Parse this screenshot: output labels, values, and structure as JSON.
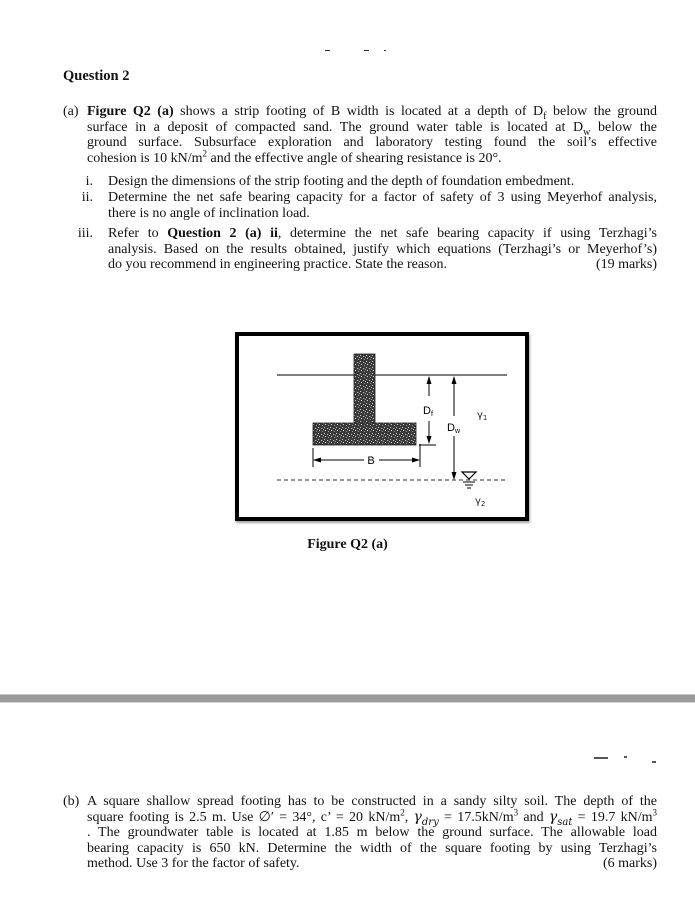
{
  "question": {
    "title": "Question 2",
    "part_a": {
      "label": "(a)",
      "lines": [
        [
          "Figure Q2 (a)",
          " shows a strip footing of B width is located at a depth of D",
          "f",
          " below the ground"
        ],
        "surface in a deposit of compacted sand. The ground water table is located at D",
        "w",
        " below the",
        "ground surface. Subsurface exploration and laboratory testing found the soil’s effective",
        "cohesion is 10 kN/m",
        "2",
        " and the effective angle of shearing resistance is 20°."
      ],
      "text": {
        "l1_bold": "Figure Q2 (a)",
        "l1_rest": " shows a strip footing of B width is located at a depth of D",
        "l1_sub": "f",
        "l1_end": " below the ground",
        "l2_a": "surface in a deposit of compacted sand. The ground water table is located at D",
        "l2_sub": "w",
        "l2_b": " below the",
        "l3": "ground surface. Subsurface exploration and laboratory testing found the soil’s effective",
        "l4_a": "cohesion is 10 kN/m",
        "l4_sup": "2",
        "l4_b": " and the effective angle of shearing resistance is 20°."
      },
      "subitems": [
        {
          "num": "i.",
          "lines": [
            "Design the dimensions of the strip footing and the depth of foundation embedment."
          ]
        },
        {
          "num": "ii.",
          "lines": [
            "Determine the net safe bearing capacity for a factor of safety of 3 using Meyerhof analysis,",
            "there is no angle of inclination load."
          ]
        },
        {
          "num": "iii.",
          "l1_a": "Refer to ",
          "l1_bold": "Question 2 (a) ii",
          "l1_b": ", determine the net safe bearing capacity if using Terzhagi’s",
          "l2": "analysis. Based on the results obtained, justify which equations (Terzhagi’s or Meyerhof’s)",
          "l3": "do you recommend in engineering practice. State the reason."
        }
      ],
      "marks": "(19 marks)"
    },
    "figure": {
      "caption": "Figure Q2 (a)",
      "labels": {
        "width": "B",
        "depth_footing": "D",
        "depth_footing_sub": "f",
        "depth_water": "D",
        "depth_water_sub": "w",
        "gamma_upper": "γ",
        "gamma_upper_sub": "1",
        "gamma_lower": "γ",
        "gamma_lower_sub": "2"
      },
      "water_table_symbol": "water-table-triangle"
    },
    "part_b": {
      "label": "(b)",
      "l1": "A square shallow spread footing has to be constructed in a sandy silty soil. The depth of the",
      "l2_a": "square footing is 2.5 m. Use ∅′ = 34°, c’ = 20 kN/m",
      "l2_sup1": "2",
      "l2_b": ", ",
      "l2_gamma1": "γ",
      "l2_sub1": "dry",
      "l2_c": " = 17.5kN/m",
      "l2_sup2": "3",
      "l2_d": " and ",
      "l2_gamma2": "γ",
      "l2_sub2": "sat",
      "l2_e": " = 19.7 kN/m",
      "l2_sup3": "3",
      "l3": ". The groundwater table is located at 1.85 m below the ground surface. The allowable load",
      "l4": "bearing capacity is 650 kN. Determine the width of the square footing by using Terzhagi’s",
      "l5": "method. Use 3 for the factor of safety.",
      "marks": "(6 marks)"
    }
  }
}
